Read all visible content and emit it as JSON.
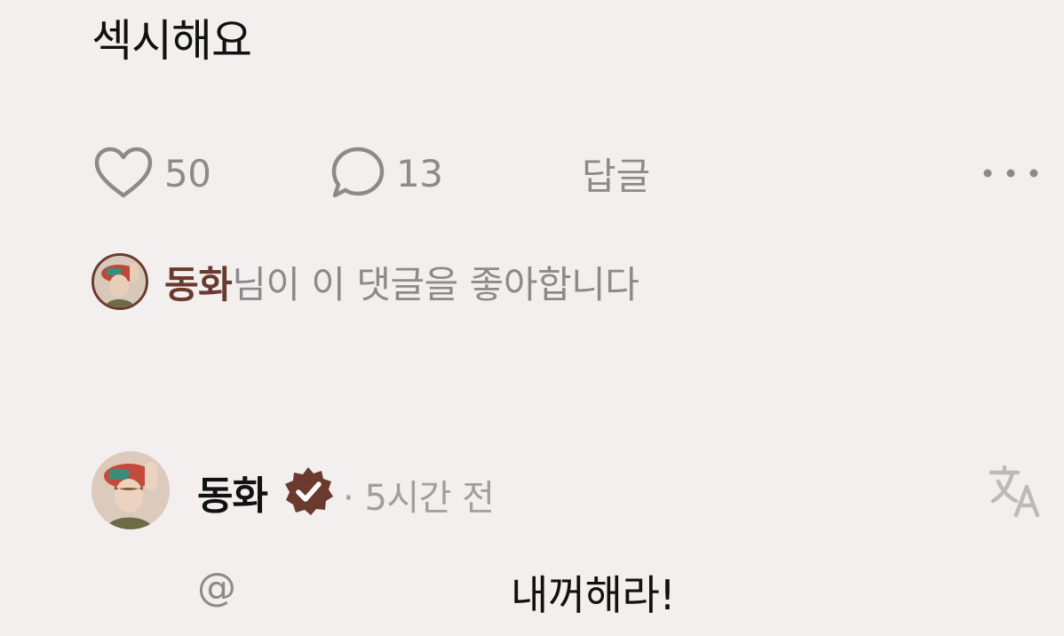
{
  "comment": {
    "text": "섹시해요"
  },
  "actions": {
    "like_icon": "heart-outline-icon",
    "like_count": "50",
    "comment_icon": "speech-bubble-icon",
    "comment_count": "13",
    "reply_label": "답글",
    "more_icon": "ellipsis-icon"
  },
  "liked_by": {
    "name": "동화",
    "suffix": "님이 이 댓글을 좋아합니다"
  },
  "reply": {
    "author": "동화",
    "verified_icon": "verified-badge-icon",
    "separator": "·",
    "time": "5시간 전",
    "translate_icon": "translate-icon",
    "mention": "@",
    "text": "내꺼해라!"
  },
  "colors": {
    "background": "#f3efef",
    "accent": "#6b3a2f",
    "muted": "#8c8a8a"
  }
}
